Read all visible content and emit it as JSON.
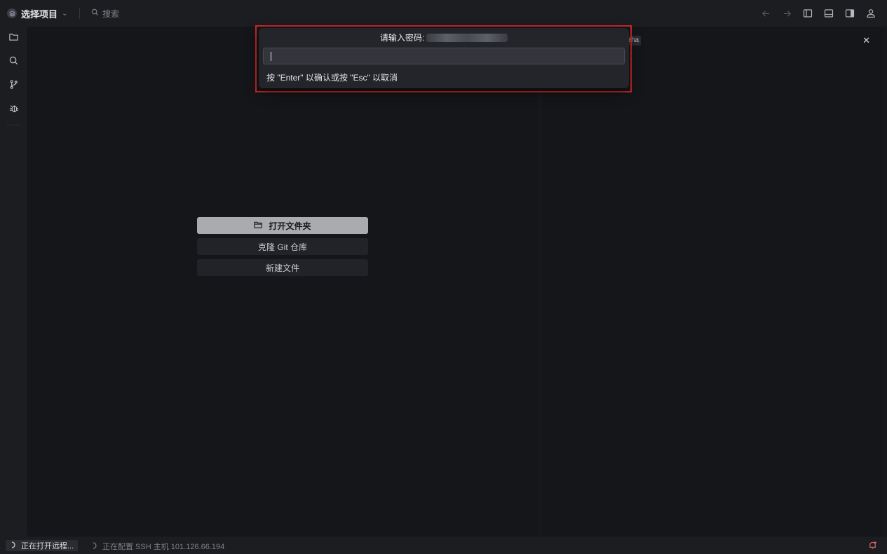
{
  "titlebar": {
    "project_name": "选择项目",
    "search_label": "搜索"
  },
  "editor": {
    "git_tag": "zha"
  },
  "welcome": {
    "open_folder": "打开文件夹",
    "clone_repo": "克隆 Git 仓库",
    "new_file": "新建文件"
  },
  "dialog": {
    "title_prefix": "请输入密码:",
    "input_value": "",
    "input_placeholder": "",
    "hint": "按 \"Enter\" 以确认或按 \"Esc\" 以取消"
  },
  "status": {
    "opening_remote": "正在打开远程...",
    "configuring_ssh": "正在配置 SSH 主机 101.126.66.194"
  },
  "icons": {
    "project": "layers-icon",
    "search": "search-icon",
    "back": "arrow-left-icon",
    "forward": "arrow-right-icon",
    "toggle_left": "panel-left-icon",
    "toggle_bottom": "panel-bottom-icon",
    "toggle_right": "panel-right-icon",
    "account": "user-icon",
    "explorer": "folder-icon",
    "git": "git-branch-icon",
    "debug": "bug-icon",
    "notifications": "bell-icon"
  },
  "colors": {
    "highlight_frame": "#d0262b",
    "primary_button": "#aaabaf",
    "bell": "#e06a70"
  }
}
